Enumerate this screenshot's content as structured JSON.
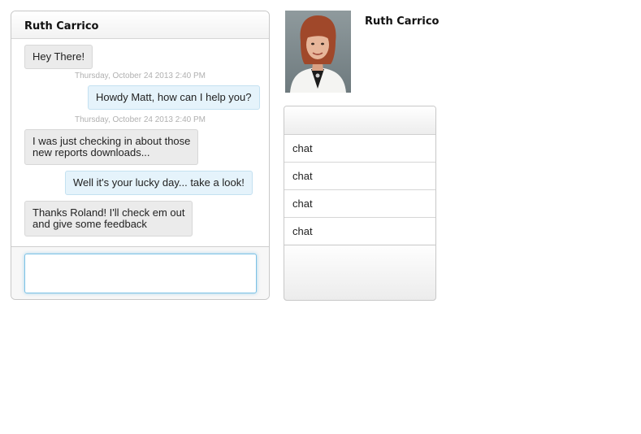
{
  "chat": {
    "contact_name": "Ruth Carrico",
    "messages": [
      {
        "direction": "in",
        "text": "Hey There!"
      },
      {
        "direction": "out",
        "text": "Howdy Matt, how can I help you?",
        "timestamp": "Thursday, October 24 2013 2:40 PM"
      },
      {
        "direction": "in",
        "lines": [
          "I was just checking in about those",
          "new reports downloads..."
        ],
        "timestamp": "Thursday, October 24 2013 2:40 PM"
      },
      {
        "direction": "out",
        "text": "Well it's your lucky day... take a look!"
      },
      {
        "direction": "in",
        "lines": [
          "Thanks Roland! I'll check em out",
          "and give some feedback"
        ]
      }
    ],
    "compose_value": ""
  },
  "profile": {
    "name": "Ruth Carrico"
  },
  "list": {
    "items": [
      "chat",
      "chat",
      "chat",
      "chat"
    ]
  }
}
